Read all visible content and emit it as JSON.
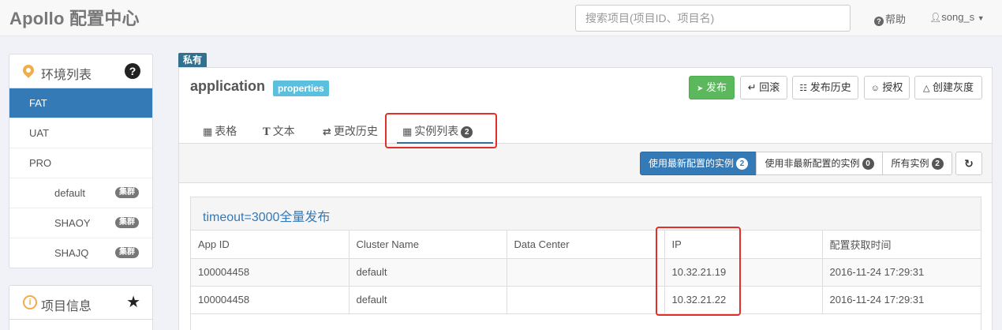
{
  "topbar": {
    "brand": "Apollo 配置中心",
    "search_placeholder": "搜索项目(项目ID、项目名)",
    "help_label": "帮助",
    "user_label": "song_s"
  },
  "env_panel": {
    "title": "环境列表",
    "items": [
      {
        "label": "FAT"
      },
      {
        "label": "UAT"
      },
      {
        "label": "PRO"
      },
      {
        "label": "default",
        "tag": "集群"
      },
      {
        "label": "SHAOY",
        "tag": "集群"
      },
      {
        "label": "SHAJQ",
        "tag": "集群"
      }
    ]
  },
  "info_panel": {
    "title": "项目信息"
  },
  "namespace": {
    "scope_tag": "私有",
    "name": "application",
    "type": "properties",
    "actions": [
      "发布",
      "回滚",
      "发布历史",
      "授权",
      "创建灰度"
    ]
  },
  "tabs": [
    {
      "icon": "table-icon",
      "label": "表格"
    },
    {
      "icon": "text-icon",
      "label": "文本"
    },
    {
      "icon": "history-icon",
      "label": "更改历史"
    },
    {
      "icon": "instances-icon",
      "label": "实例列表",
      "count": "2"
    }
  ],
  "filters": [
    {
      "label": "使用最新配置的实例",
      "count": "2"
    },
    {
      "label": "使用非最新配置的实例",
      "count": "0"
    },
    {
      "label": "所有实例",
      "count": "2"
    }
  ],
  "release": {
    "title": "timeout=3000全量发布",
    "columns": [
      "App ID",
      "Cluster Name",
      "Data Center",
      "IP",
      "配置获取时间"
    ],
    "rows": [
      [
        "100004458",
        "default",
        "",
        "10.32.21.19",
        "2016-11-24 17:29:31"
      ],
      [
        "100004458",
        "default",
        "",
        "10.32.21.22",
        "2016-11-24 17:29:31"
      ]
    ]
  },
  "colors": {
    "primary": "#337ab7",
    "success": "#5cb85c",
    "info": "#5bc0de",
    "highlight_box": "#e0302a"
  }
}
